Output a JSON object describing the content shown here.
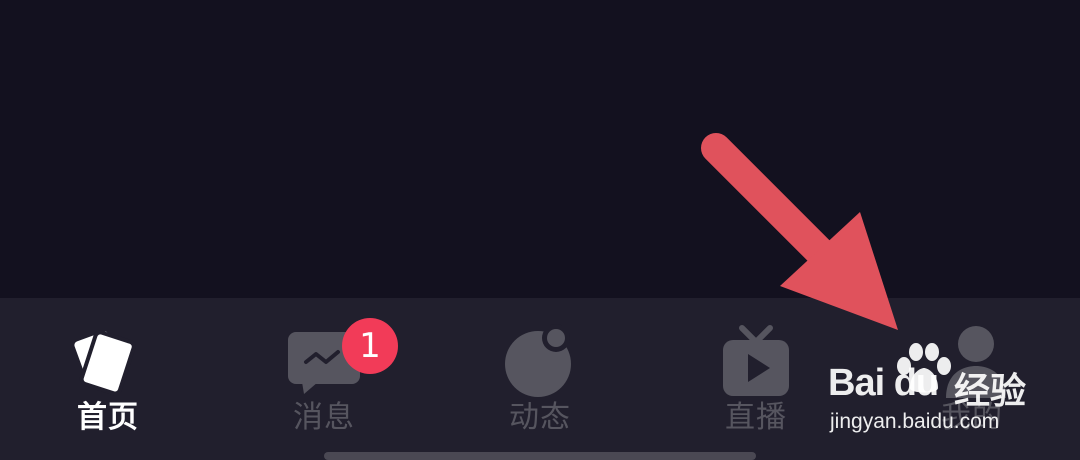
{
  "tabs": [
    {
      "label": "首页",
      "icon": "cards-icon",
      "active": true
    },
    {
      "label": "消息",
      "icon": "message-icon",
      "active": false
    },
    {
      "label": "动态",
      "icon": "moment-icon",
      "active": false
    },
    {
      "label": "直播",
      "icon": "tv-play-icon",
      "active": false
    },
    {
      "label": "我的",
      "icon": "person-icon",
      "active": false
    }
  ],
  "badge": {
    "count": "1"
  },
  "watermark": {
    "brand": "Bai du",
    "cn": "经验",
    "url": "jingyan.baidu.com"
  },
  "colors": {
    "background": "#13111f",
    "tabbar": "#211f2d",
    "active_label": "#ffffff",
    "inactive": "#56555f",
    "badge": "#f23b58",
    "annotation_arrow": "#e0525c"
  }
}
